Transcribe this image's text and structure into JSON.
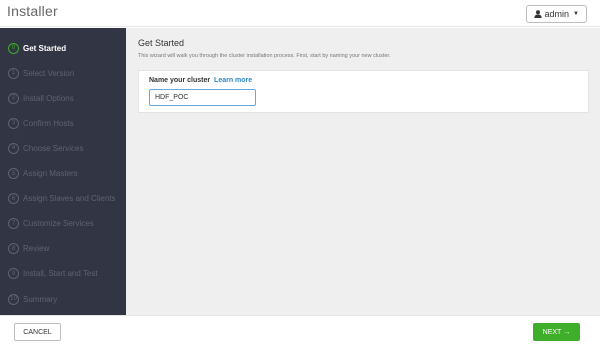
{
  "header": {
    "app_title": "Installer",
    "user_label": "admin",
    "user_icon": "user-icon",
    "caret_icon": "caret-down-icon"
  },
  "sidebar": {
    "steps": [
      {
        "number": "0",
        "label": "Get Started",
        "active": true
      },
      {
        "number": "1",
        "label": "Select Version",
        "active": false
      },
      {
        "number": "2",
        "label": "Install Options",
        "active": false
      },
      {
        "number": "3",
        "label": "Confirm Hosts",
        "active": false
      },
      {
        "number": "4",
        "label": "Choose Services",
        "active": false
      },
      {
        "number": "5",
        "label": "Assign Masters",
        "active": false
      },
      {
        "number": "6",
        "label": "Assign Slaves and Clients",
        "active": false
      },
      {
        "number": "7",
        "label": "Customize Services",
        "active": false
      },
      {
        "number": "8",
        "label": "Review",
        "active": false
      },
      {
        "number": "9",
        "label": "Install, Start and Test",
        "active": false
      },
      {
        "number": "10",
        "label": "Summary",
        "active": false
      }
    ]
  },
  "main": {
    "title": "Get Started",
    "description": "This wizard will walk you through the cluster installation process. First, start by naming your new cluster.",
    "field_label": "Name your cluster",
    "learn_more": "Learn more",
    "cluster_name_value": "HDF_POC"
  },
  "footer": {
    "cancel_label": "CANCEL",
    "next_label": "NEXT",
    "next_arrow": "→"
  },
  "colors": {
    "sidebar_bg": "#323544",
    "accent_green": "#3fae2a",
    "link_blue": "#2f86c6"
  }
}
